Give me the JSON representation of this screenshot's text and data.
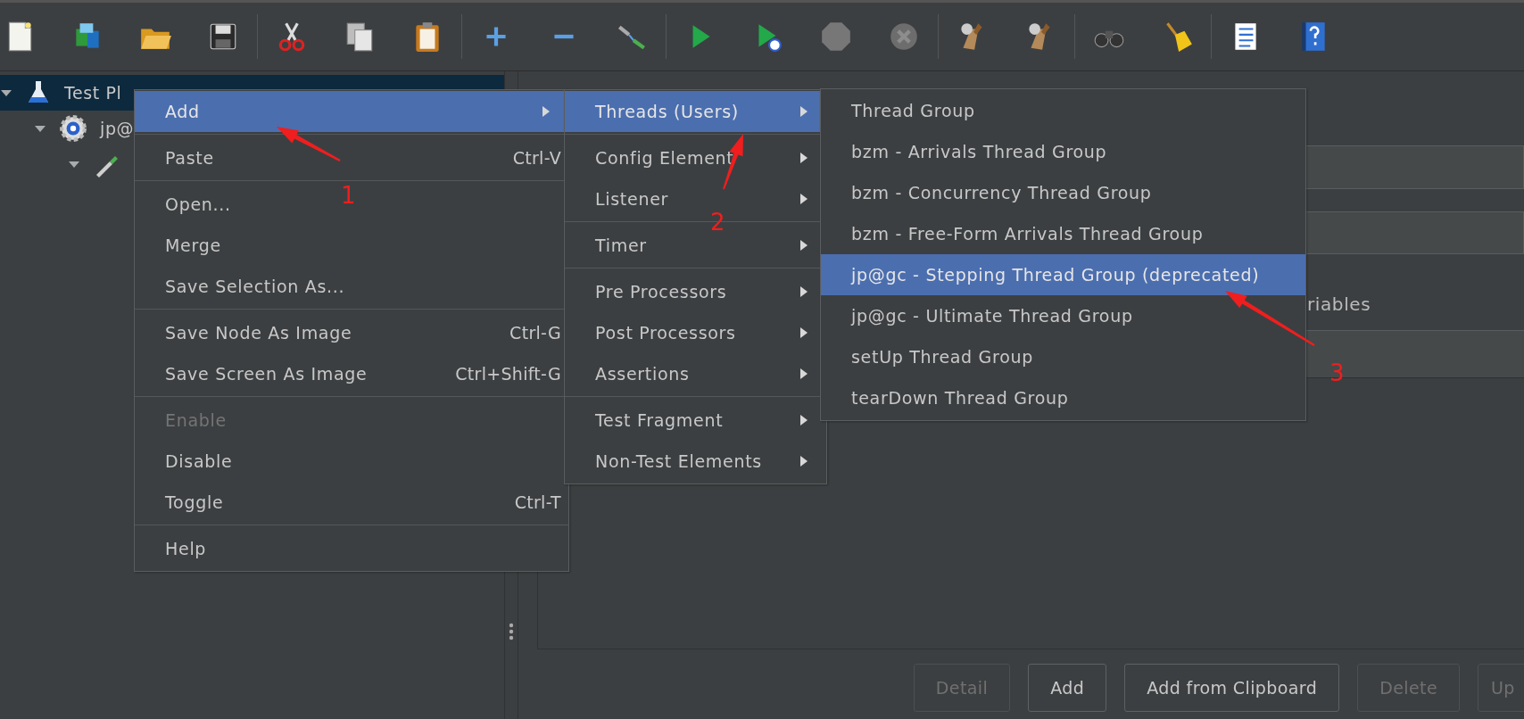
{
  "tree": [
    {
      "label": "Test Pl",
      "expanded": true,
      "selected": true,
      "children": [
        {
          "label": "jp@",
          "expanded": true,
          "selected": false,
          "children": [
            {
              "expanded": true,
              "selected": false
            }
          ]
        }
      ]
    }
  ],
  "menus": [
    {
      "items": [
        {
          "kind": "item",
          "label": "Add",
          "submenu": true,
          "selected": true,
          "disabled": false
        },
        {
          "kind": "separator"
        },
        {
          "kind": "item",
          "label": "Paste",
          "shortcut": "Ctrl-V",
          "submenu": false,
          "selected": false,
          "disabled": false
        },
        {
          "kind": "separator"
        },
        {
          "kind": "item",
          "label": "Open...",
          "submenu": false,
          "selected": false,
          "disabled": false
        },
        {
          "kind": "item",
          "label": "Merge",
          "submenu": false,
          "selected": false,
          "disabled": false
        },
        {
          "kind": "item",
          "label": "Save Selection As...",
          "submenu": false,
          "selected": false,
          "disabled": false
        },
        {
          "kind": "separator"
        },
        {
          "kind": "item",
          "label": "Save Node As Image",
          "shortcut": "Ctrl-G",
          "submenu": false,
          "selected": false,
          "disabled": false
        },
        {
          "kind": "item",
          "label": "Save Screen As Image",
          "shortcut": "Ctrl+Shift-G",
          "submenu": false,
          "selected": false,
          "disabled": false
        },
        {
          "kind": "separator"
        },
        {
          "kind": "item",
          "label": "Enable",
          "submenu": false,
          "selected": false,
          "disabled": true
        },
        {
          "kind": "item",
          "label": "Disable",
          "submenu": false,
          "selected": false,
          "disabled": false
        },
        {
          "kind": "item",
          "label": "Toggle",
          "shortcut": "Ctrl-T",
          "submenu": false,
          "selected": false,
          "disabled": false
        },
        {
          "kind": "separator"
        },
        {
          "kind": "item",
          "label": "Help",
          "submenu": false,
          "selected": false,
          "disabled": false
        }
      ]
    },
    {
      "items": [
        {
          "kind": "item",
          "label": "Threads (Users)",
          "submenu": true,
          "selected": true,
          "disabled": false
        },
        {
          "kind": "separator"
        },
        {
          "kind": "item",
          "label": "Config Element",
          "submenu": true,
          "selected": false,
          "disabled": false
        },
        {
          "kind": "item",
          "label": "Listener",
          "submenu": true,
          "selected": false,
          "disabled": false
        },
        {
          "kind": "separator"
        },
        {
          "kind": "item",
          "label": "Timer",
          "submenu": true,
          "selected": false,
          "disabled": false
        },
        {
          "kind": "separator"
        },
        {
          "kind": "item",
          "label": "Pre Processors",
          "submenu": true,
          "selected": false,
          "disabled": false
        },
        {
          "kind": "item",
          "label": "Post Processors",
          "submenu": true,
          "selected": false,
          "disabled": false
        },
        {
          "kind": "item",
          "label": "Assertions",
          "submenu": true,
          "selected": false,
          "disabled": false
        },
        {
          "kind": "separator"
        },
        {
          "kind": "item",
          "label": "Test Fragment",
          "submenu": true,
          "selected": false,
          "disabled": false
        },
        {
          "kind": "item",
          "label": "Non-Test Elements",
          "submenu": true,
          "selected": false,
          "disabled": false
        }
      ]
    },
    {
      "items": [
        {
          "kind": "item",
          "label": "Thread Group",
          "submenu": false,
          "selected": false,
          "disabled": false
        },
        {
          "kind": "item",
          "label": "bzm - Arrivals Thread Group",
          "submenu": false,
          "selected": false,
          "disabled": false
        },
        {
          "kind": "item",
          "label": "bzm - Concurrency Thread Group",
          "submenu": false,
          "selected": false,
          "disabled": false
        },
        {
          "kind": "item",
          "label": "bzm - Free-Form Arrivals Thread Group",
          "submenu": false,
          "selected": false,
          "disabled": false
        },
        {
          "kind": "item",
          "label": "jp@gc - Stepping Thread Group (deprecated)",
          "submenu": false,
          "selected": true,
          "disabled": false
        },
        {
          "kind": "item",
          "label": "jp@gc - Ultimate Thread Group",
          "submenu": false,
          "selected": false,
          "disabled": false
        },
        {
          "kind": "item",
          "label": "setUp Thread Group",
          "submenu": false,
          "selected": false,
          "disabled": false
        },
        {
          "kind": "item",
          "label": "tearDown Thread Group",
          "submenu": false,
          "selected": false,
          "disabled": false
        }
      ]
    }
  ],
  "panel": {
    "partial_label": "riables",
    "buttons": [
      {
        "label": "Detail",
        "disabled": true
      },
      {
        "label": "Add",
        "disabled": false
      },
      {
        "label": "Add from Clipboard",
        "disabled": false
      },
      {
        "label": "Delete",
        "disabled": true
      },
      {
        "label": "Up",
        "disabled": true
      }
    ]
  },
  "annotations": [
    {
      "label": "1"
    },
    {
      "label": "2"
    },
    {
      "label": "3"
    }
  ]
}
